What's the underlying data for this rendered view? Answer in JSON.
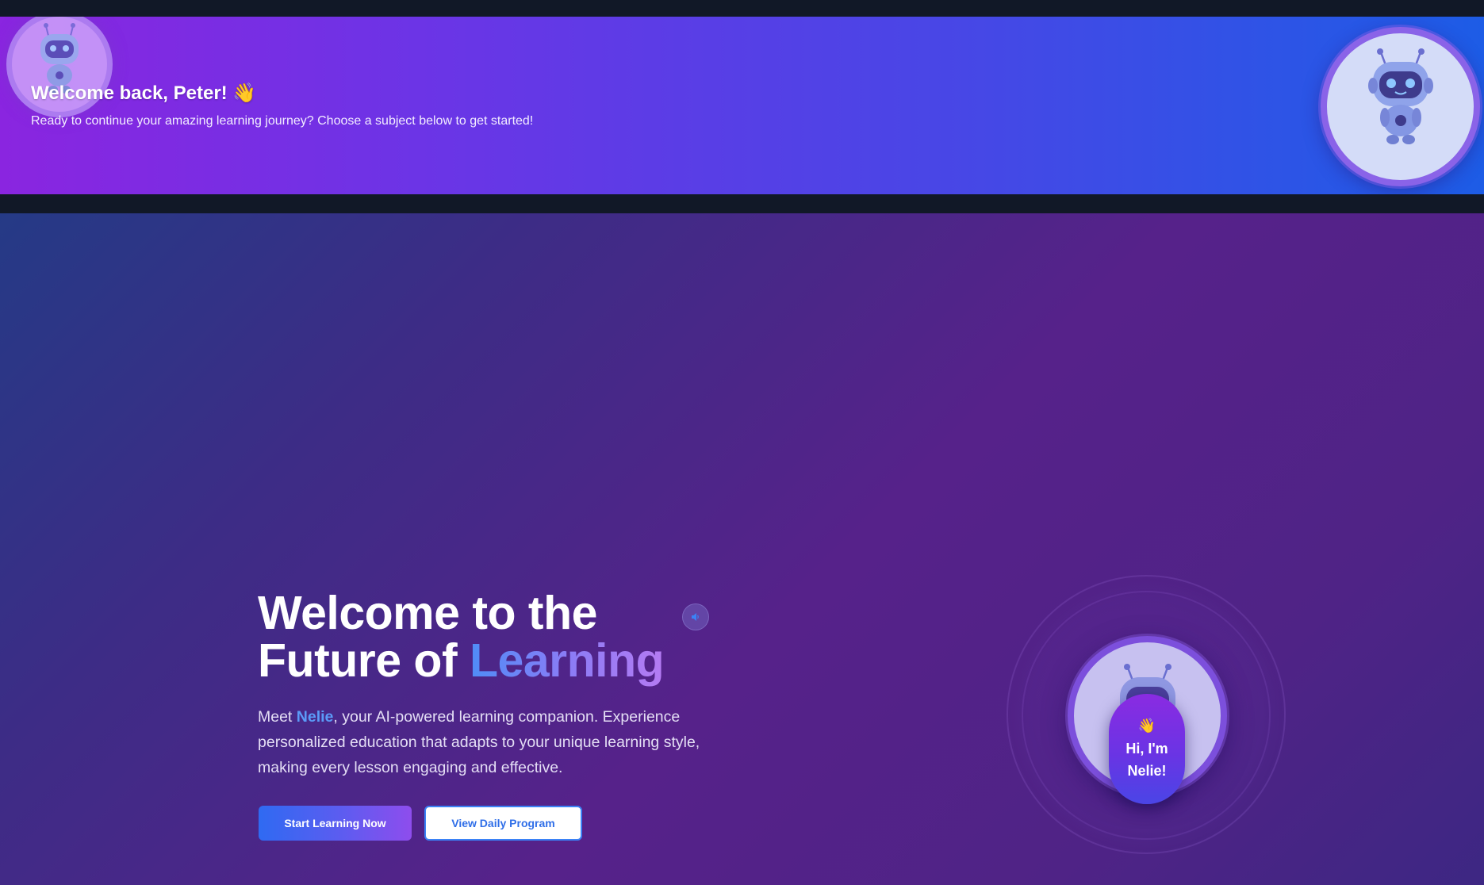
{
  "banner": {
    "title": "Welcome back, Peter! 👋",
    "subtitle": "Ready to continue your amazing learning journey? Choose a subject below to get started!"
  },
  "hero": {
    "title_line1": "Welcome to the",
    "title_line2_start": "Future of ",
    "title_line2_accent": "Learning",
    "desc_prefix": "Meet ",
    "desc_name": "Nelie",
    "desc_suffix": ", your AI-powered learning companion. Experience personalized education that adapts to your unique learning style, making every lesson engaging and effective.",
    "primary_button": "Start Learning Now",
    "secondary_button": "View Daily Program"
  },
  "mascot": {
    "wave": "👋",
    "greeting": "Hi, I'm Nelie!"
  },
  "icons": {
    "sound": "speaker-icon",
    "robot": "robot-icon"
  },
  "colors": {
    "accent_blue": "#3b82f6",
    "accent_purple": "#8b5cf6",
    "background_dark": "#111827"
  }
}
